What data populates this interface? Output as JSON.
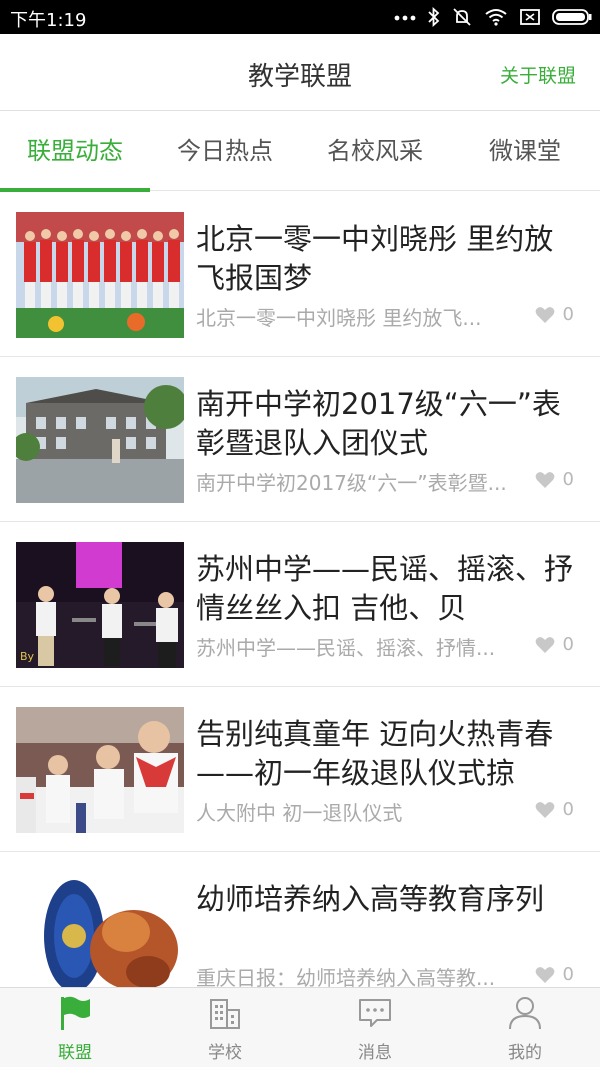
{
  "status_bar": {
    "time": "下午1:19"
  },
  "header": {
    "title": "教学联盟",
    "action": "关于联盟"
  },
  "tabs": [
    {
      "label": "联盟动态",
      "active": true
    },
    {
      "label": "今日热点",
      "active": false
    },
    {
      "label": "名校风采",
      "active": false
    },
    {
      "label": "微课堂",
      "active": false
    }
  ],
  "news": [
    {
      "title": "北京一零一中刘晓彤 里约放飞报国梦",
      "subtitle": "北京一零一中刘晓彤 里约放飞...",
      "likes": "0",
      "image": "gymnastics-team-photo"
    },
    {
      "title": "南开中学初2017级“六一”表彰暨退队入团仪式",
      "subtitle": "南开中学初2017级“六一”表彰暨...",
      "likes": "0",
      "image": "school-building-photo"
    },
    {
      "title": "苏州中学——民谣、摇滚、抒情丝丝入扣 吉他、贝",
      "subtitle": "苏州中学——民谣、摇滚、抒情...",
      "likes": "0",
      "image": "stage-violin-performance-photo"
    },
    {
      "title": "告别纯真童年 迈向火热青春 ——初一年级退队仪式掠",
      "subtitle": "人大附中 初一退队仪式",
      "likes": "0",
      "image": "students-ceremony-photo"
    },
    {
      "title": "幼师培养纳入高等教育序列",
      "subtitle": "重庆日报：幼师培养纳入高等教...",
      "likes": "0",
      "image": "emblem-and-food-photo"
    }
  ],
  "bottom_nav": [
    {
      "label": "联盟",
      "icon": "flag-icon",
      "active": true
    },
    {
      "label": "学校",
      "icon": "building-icon",
      "active": false
    },
    {
      "label": "消息",
      "icon": "message-icon",
      "active": false
    },
    {
      "label": "我的",
      "icon": "profile-icon",
      "active": false
    }
  ],
  "colors": {
    "accent": "#3aae3a",
    "text": "#222222",
    "muted": "#aaaaaa"
  }
}
